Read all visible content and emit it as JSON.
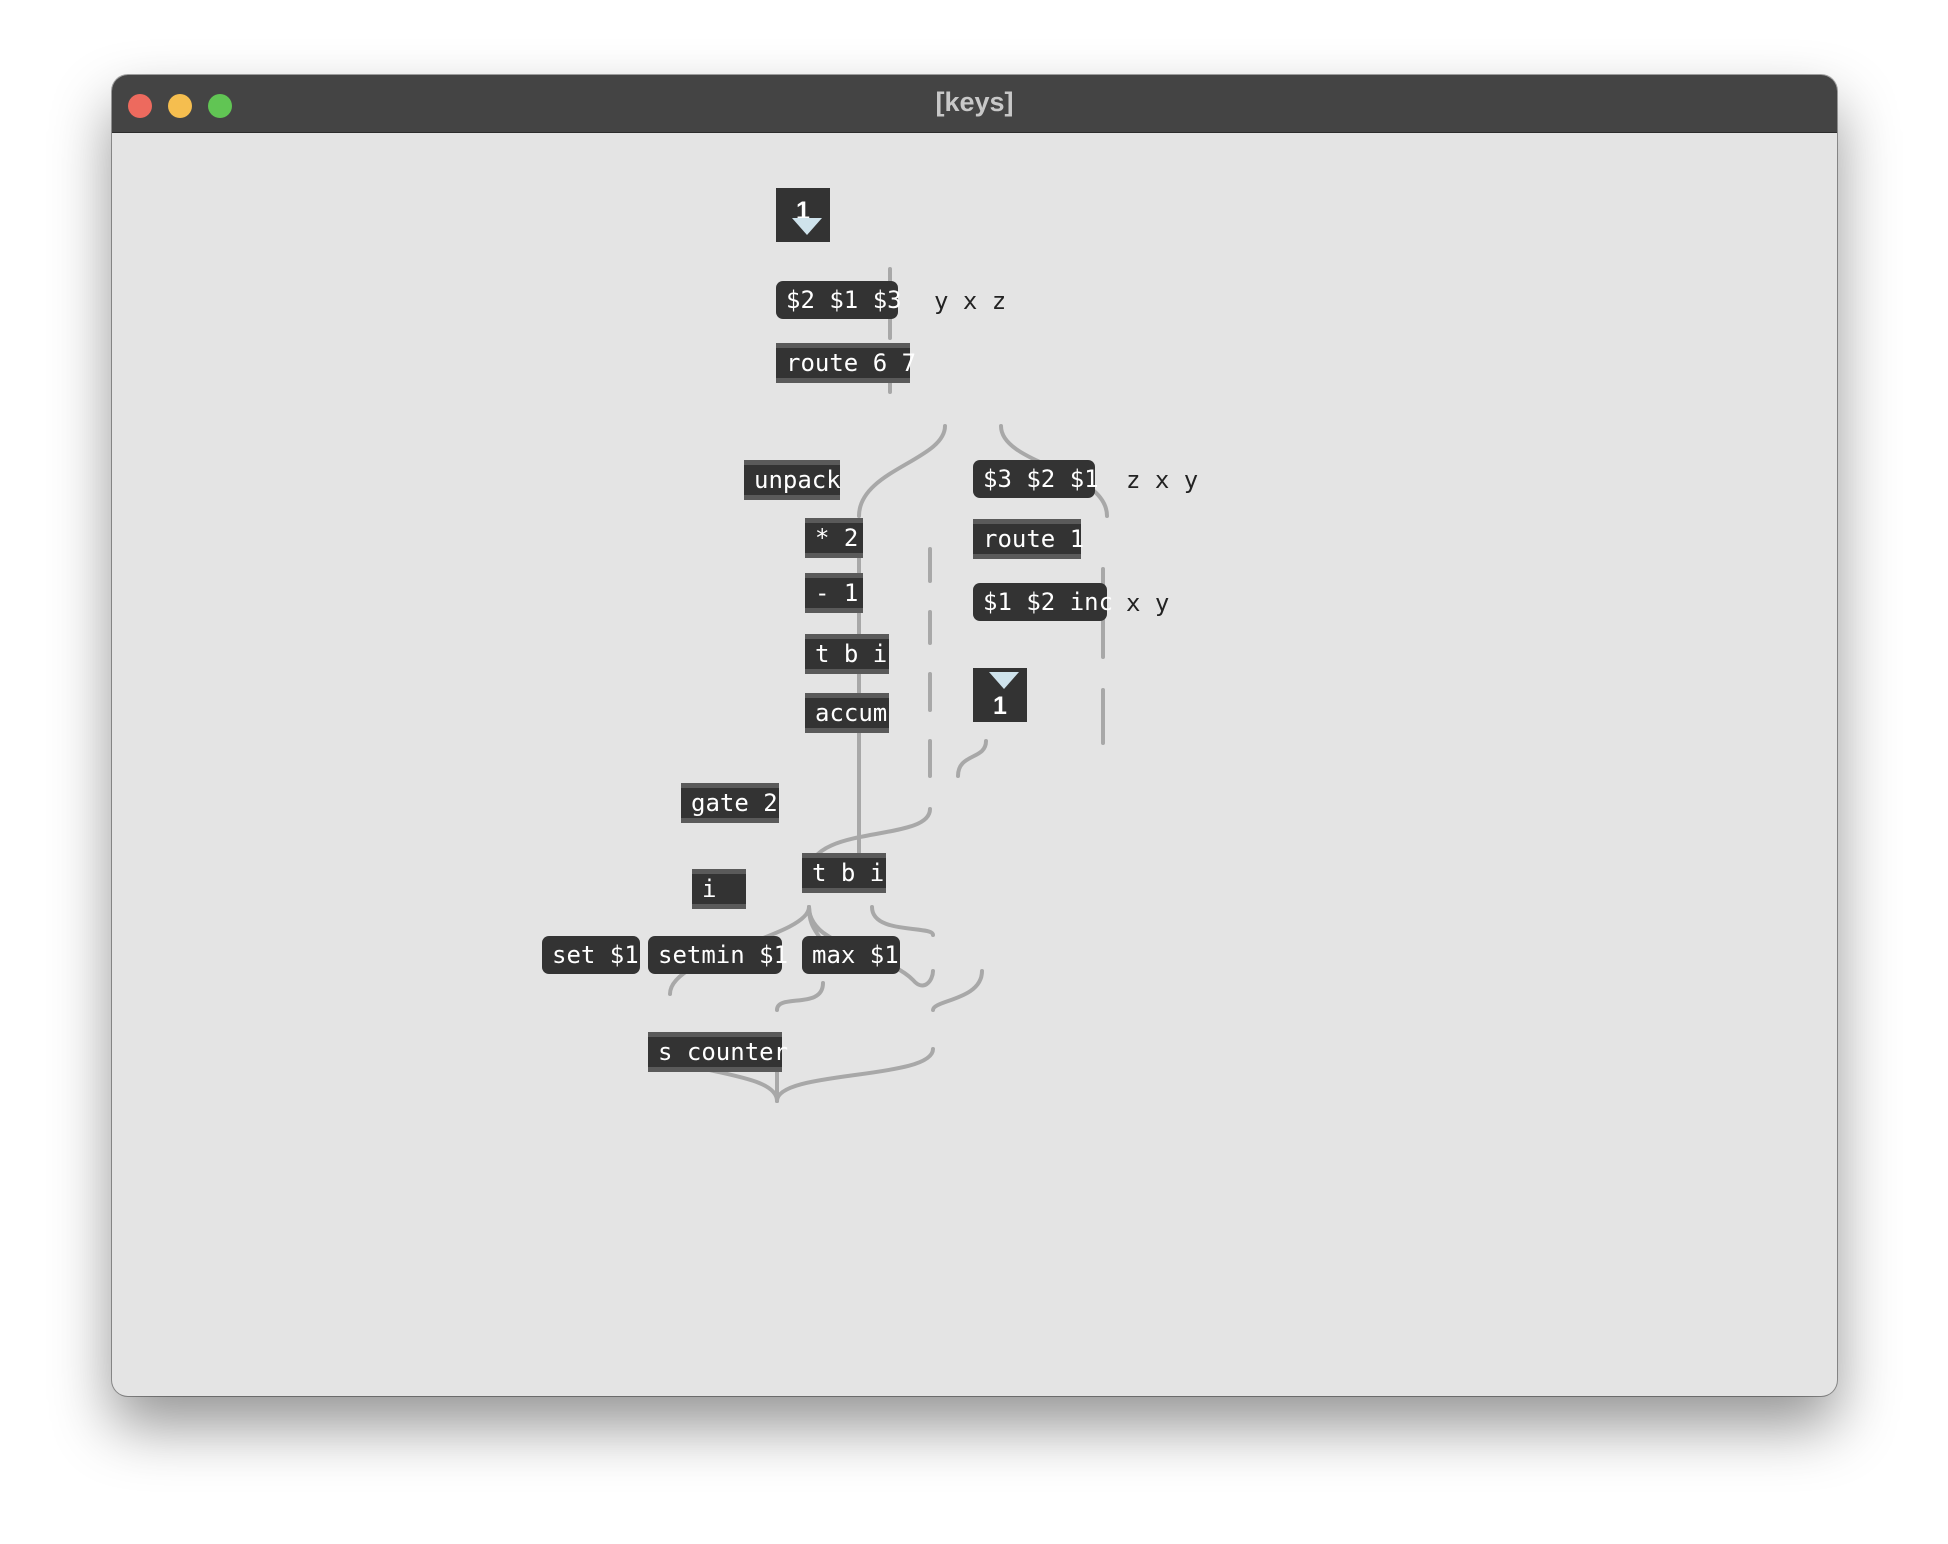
{
  "window": {
    "title": "[keys]",
    "controls": [
      "close",
      "minimize",
      "zoom"
    ]
  },
  "patch": {
    "number_in": "1",
    "number_out": "1",
    "objects": {
      "swap_msg": "$2 $1 $3",
      "route_67": "route 6 7",
      "unpack": "unpack",
      "mult": "* 2",
      "minus": "- 1",
      "tbi_top": "t b i",
      "accum": "accum",
      "gate": "gate 2",
      "int": "i",
      "tbi_bottom": "t b i",
      "set_msg": "set $1",
      "setmin_msg": "setmin $1",
      "max_msg": "max $1",
      "send": "s counter",
      "zxy_msg": "$3 $2 $1",
      "route_1": "route 1",
      "inc_msg": "$1 $2 inc"
    },
    "comments": {
      "yxz": "y x z",
      "zxy": "z x y",
      "xy": "x y"
    }
  },
  "colors": {
    "canvas": "#e4e4e4",
    "box": "#333333",
    "box_border": "#5a5a5a",
    "wire": "#a8a8a8",
    "titlebar": "#444444"
  }
}
